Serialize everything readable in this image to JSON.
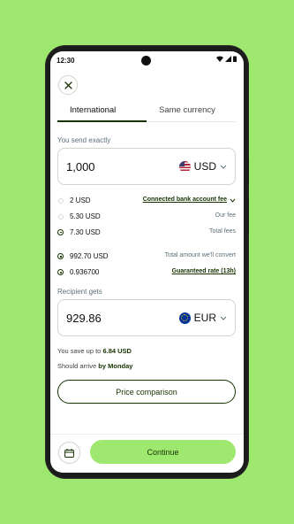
{
  "status_bar": {
    "time": "12:30"
  },
  "tabs": [
    {
      "label": "International",
      "active": true
    },
    {
      "label": "Same currency",
      "active": false
    }
  ],
  "send": {
    "label": "You send exactly",
    "amount": "1,000",
    "currency": "USD",
    "flag": "us-flag-icon"
  },
  "fees": [
    {
      "amount": "2 USD",
      "description": "Connected bank account fee",
      "link": true
    },
    {
      "amount": "5.30 USD",
      "description": "Our fee",
      "link": false
    },
    {
      "amount": "7.30 USD",
      "description": "Total fees",
      "link": false
    },
    {
      "amount": "992.70 USD",
      "description": "Total amount we'll convert",
      "link": false
    },
    {
      "amount": "0.936700",
      "description": "Guaranteed rate (13h)",
      "link": true
    }
  ],
  "recipient": {
    "label": "Recipient gets",
    "amount": "929.86",
    "currency": "EUR",
    "flag": "eu-flag-icon"
  },
  "savings": {
    "prefix": "You save up to",
    "value": "6.84 USD"
  },
  "arrival": {
    "prefix": "Should arrive",
    "value": "by Monday"
  },
  "buttons": {
    "price_comparison": "Price comparison",
    "continue": "Continue"
  },
  "colors": {
    "brand_green": "#9fe870",
    "forest": "#163300",
    "muted": "#5d7079"
  }
}
